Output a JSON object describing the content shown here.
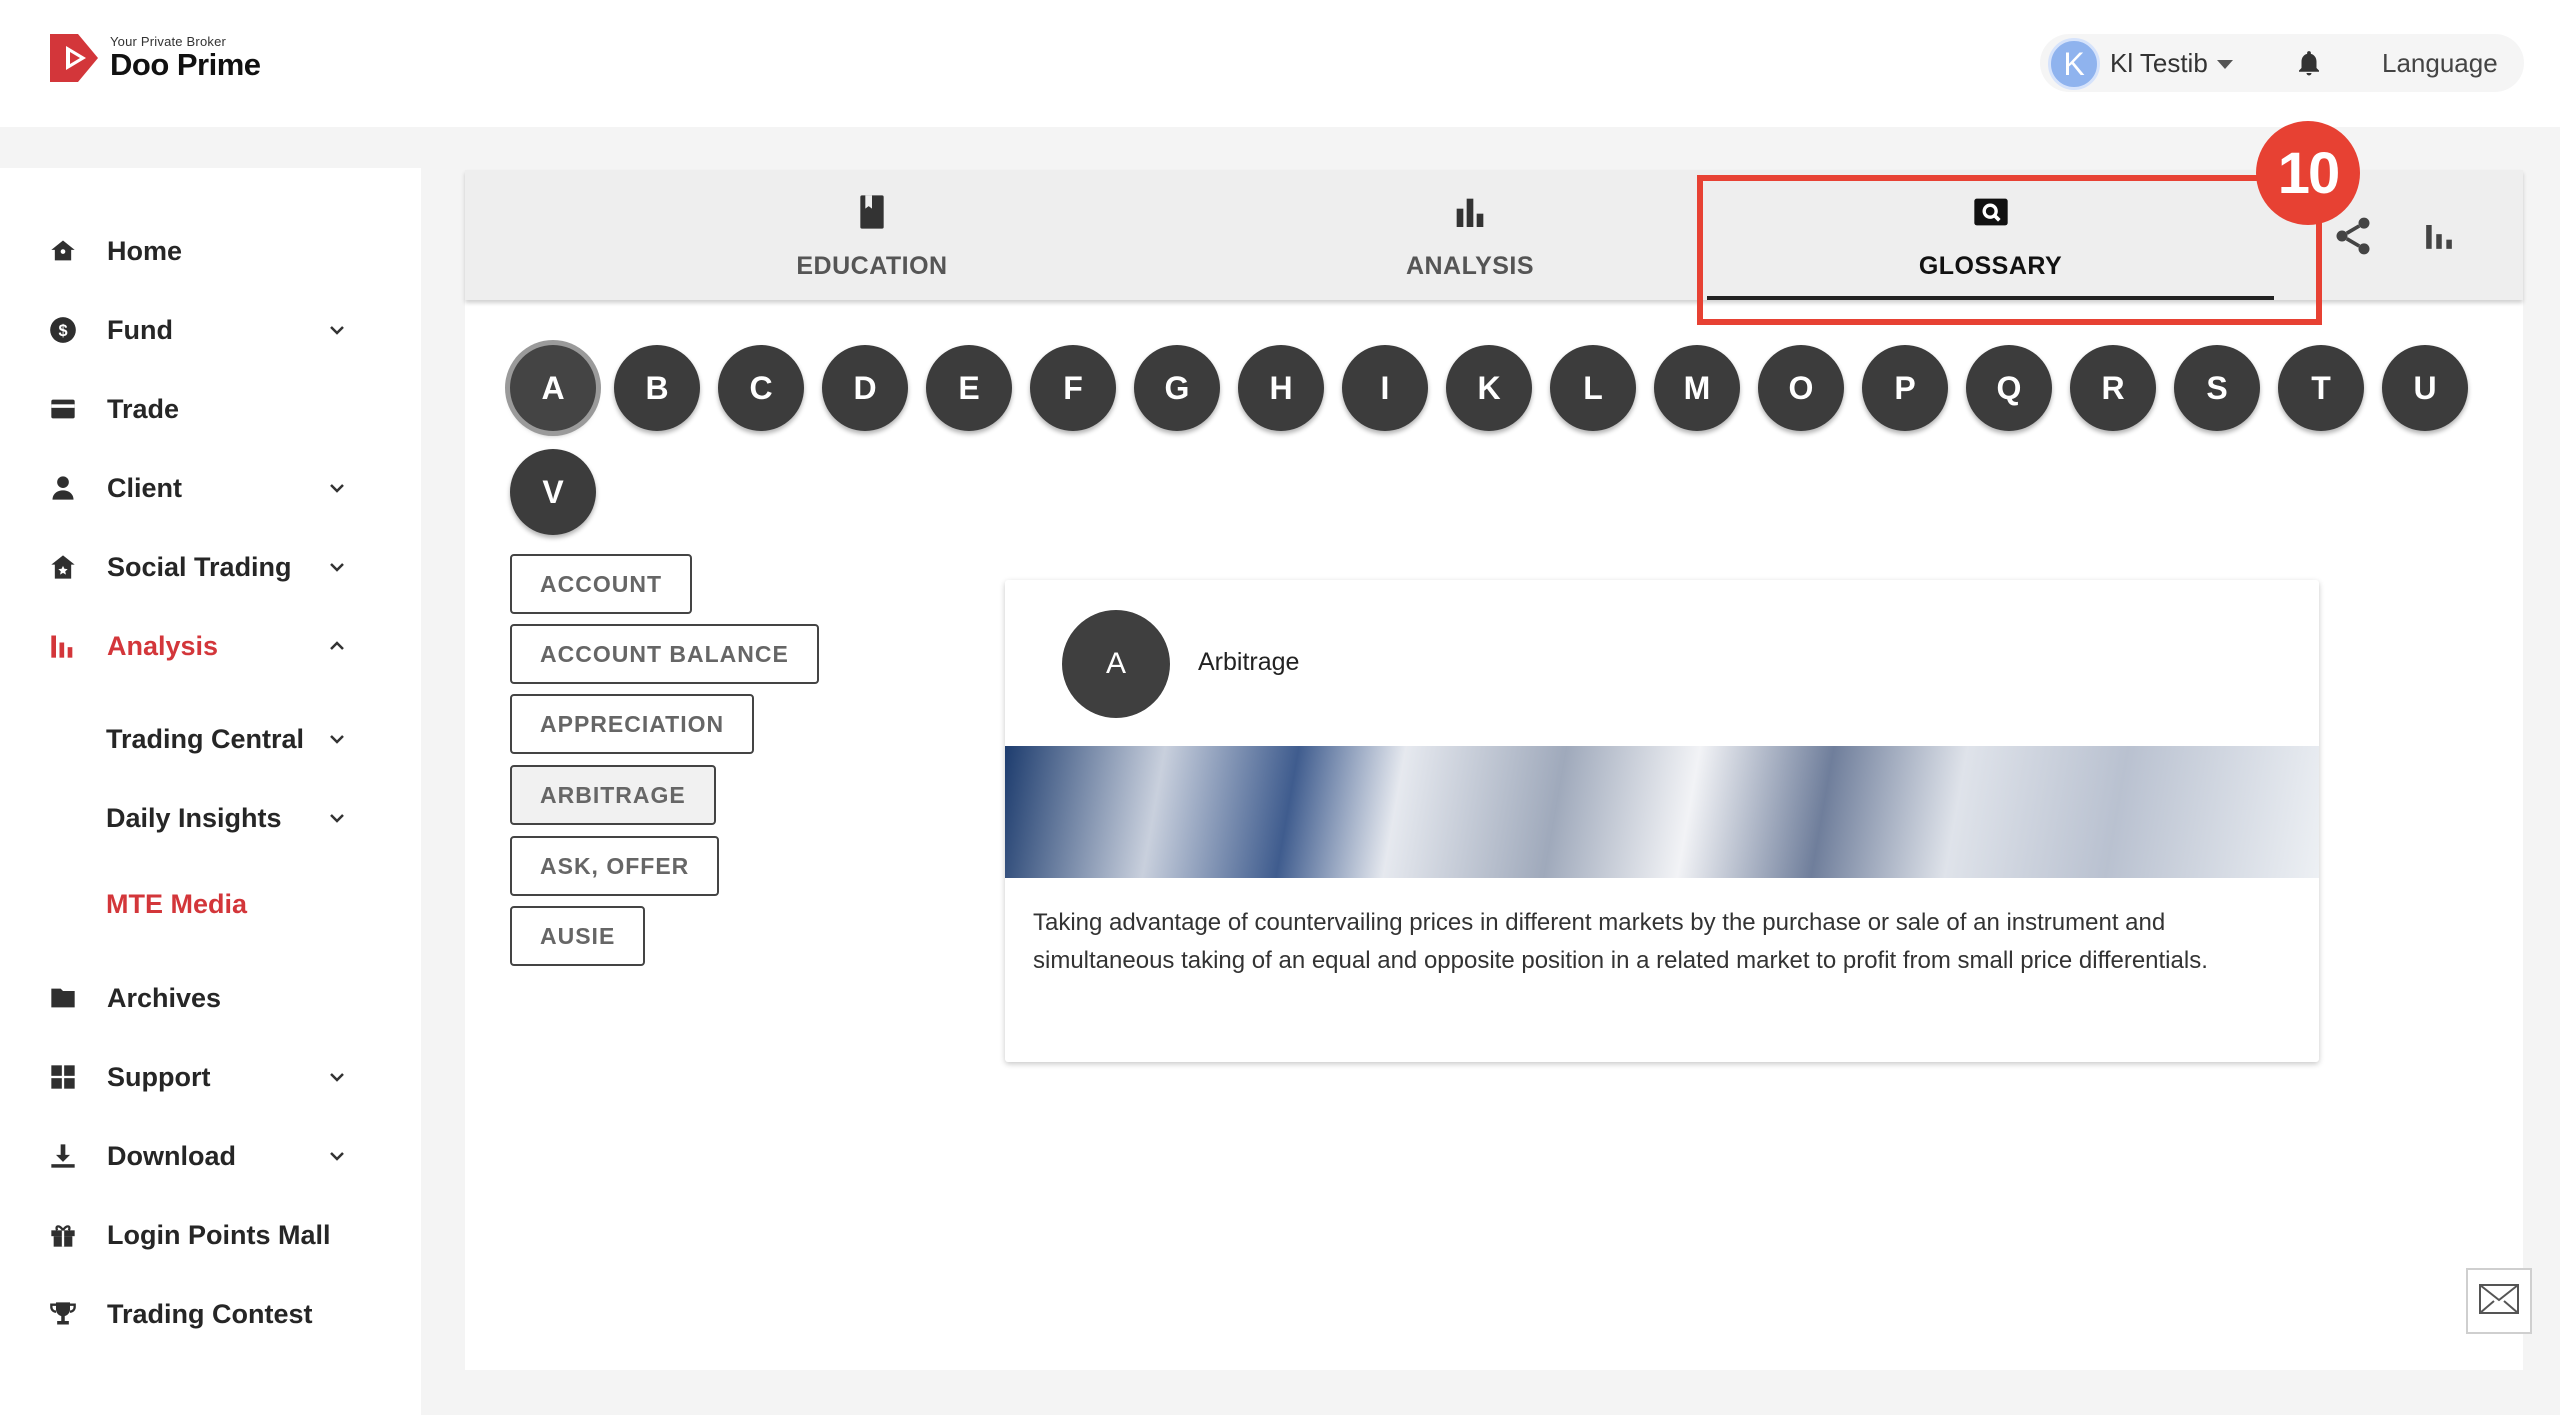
{
  "header": {
    "logo_tagline": "Your Private Broker",
    "logo_name": "Doo Prime",
    "avatar_letter": "K",
    "user_name": "Kl Testib",
    "language_label": "Language",
    "brand_color": "#d3363a"
  },
  "sidebar": {
    "items": [
      {
        "label": "Home",
        "icon": "home-icon"
      },
      {
        "label": "Fund",
        "icon": "dollar-icon"
      },
      {
        "label": "Trade",
        "icon": "card-icon"
      },
      {
        "label": "Client",
        "icon": "person-icon"
      },
      {
        "label": "Social Trading",
        "icon": "house-star-icon"
      },
      {
        "label": "Analysis",
        "icon": "bar-chart-icon"
      },
      {
        "label": "Trading Central"
      },
      {
        "label": "Daily Insights"
      },
      {
        "label": "MTE Media"
      },
      {
        "label": "Archives",
        "icon": "folder-icon"
      },
      {
        "label": "Support",
        "icon": "grid-icon"
      },
      {
        "label": "Download",
        "icon": "download-icon"
      },
      {
        "label": "Login Points Mall",
        "icon": "gift-icon"
      },
      {
        "label": "Trading Contest",
        "icon": "trophy-icon"
      }
    ]
  },
  "tabs": [
    {
      "label": "EDUCATION",
      "icon": "book-icon"
    },
    {
      "label": "ANALYSIS",
      "icon": "bar-chart-icon"
    },
    {
      "label": "GLOSSARY",
      "icon": "search-icon",
      "active": true
    }
  ],
  "annotation": {
    "step_number": "10",
    "color": "#e74133"
  },
  "letters": [
    "A",
    "B",
    "C",
    "D",
    "E",
    "F",
    "G",
    "H",
    "I",
    "K",
    "L",
    "M",
    "O",
    "P",
    "Q",
    "R",
    "S",
    "T",
    "U",
    "V"
  ],
  "active_letter": "A",
  "terms": [
    "ACCOUNT",
    "ACCOUNT BALANCE",
    "APPRECIATION",
    "ARBITRAGE",
    "ASK, OFFER",
    "AUSIE"
  ],
  "selected_term": "ARBITRAGE",
  "card": {
    "avatar_letter": "A",
    "title": "Arbitrage",
    "description": "Taking advantage of countervailing prices in different markets by the purchase or sale of an instrument and simultaneous taking of an equal and opposite position in a related market to profit from small price differentials."
  }
}
